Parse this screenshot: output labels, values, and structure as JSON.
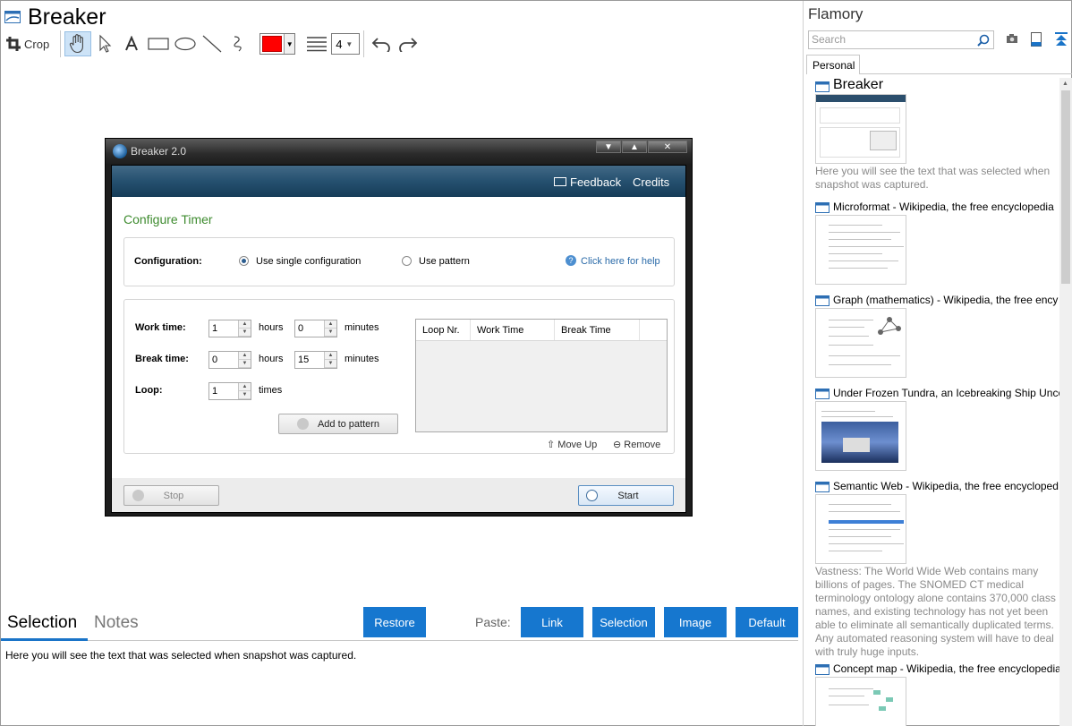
{
  "app": {
    "title": "Breaker"
  },
  "toolbar": {
    "crop_label": "Crop",
    "line_width": "4"
  },
  "breaker": {
    "window_title": "Breaker 2.0",
    "feedback": "Feedback",
    "credits": "Credits",
    "configure_title": "Configure Timer",
    "configuration_label": "Configuration:",
    "single_config": "Use single configuration",
    "pattern": "Use pattern",
    "help": "Click here for help",
    "work_time_label": "Work time:",
    "break_time_label": "Break time:",
    "loop_label": "Loop:",
    "work_hours": "1",
    "work_minutes": "0",
    "break_hours": "0",
    "break_minutes": "15",
    "loop_value": "1",
    "hours": "hours",
    "minutes": "minutes",
    "times": "times",
    "add_to_pattern": "Add to pattern",
    "columns": [
      "Loop Nr.",
      "Work Time",
      "Break Time"
    ],
    "move_up": "Move Up",
    "remove": "Remove",
    "stop": "Stop",
    "start": "Start"
  },
  "bottom": {
    "tab_selection": "Selection",
    "tab_notes": "Notes",
    "restore": "Restore",
    "paste_label": "Paste:",
    "link": "Link",
    "selection": "Selection",
    "image": "Image",
    "default": "Default",
    "selected_text": "Here you will see the text that was selected when snapshot was captured."
  },
  "sidebar": {
    "title": "Flamory",
    "search_placeholder": "Search",
    "tab_personal": "Personal",
    "items": [
      {
        "title": "Breaker",
        "desc": "Here you will see the text that was selected when snapshot was captured."
      },
      {
        "title": "Microformat - Wikipedia, the free encyclopedia"
      },
      {
        "title": "Graph (mathematics) - Wikipedia, the free ency"
      },
      {
        "title": "Under Frozen Tundra, an Icebreaking Ship Unco"
      },
      {
        "title": "Semantic Web - Wikipedia, the free encycloped",
        "desc": "Vastness: The World Wide Web contains many billions of pages. The SNOMED CT medical terminology ontology alone contains 370,000 class names, and existing technology has not yet been able to eliminate all semantically duplicated terms. Any automated reasoning system will have to deal with truly huge inputs."
      },
      {
        "title": "Concept map - Wikipedia, the free encyclopedia"
      }
    ]
  }
}
